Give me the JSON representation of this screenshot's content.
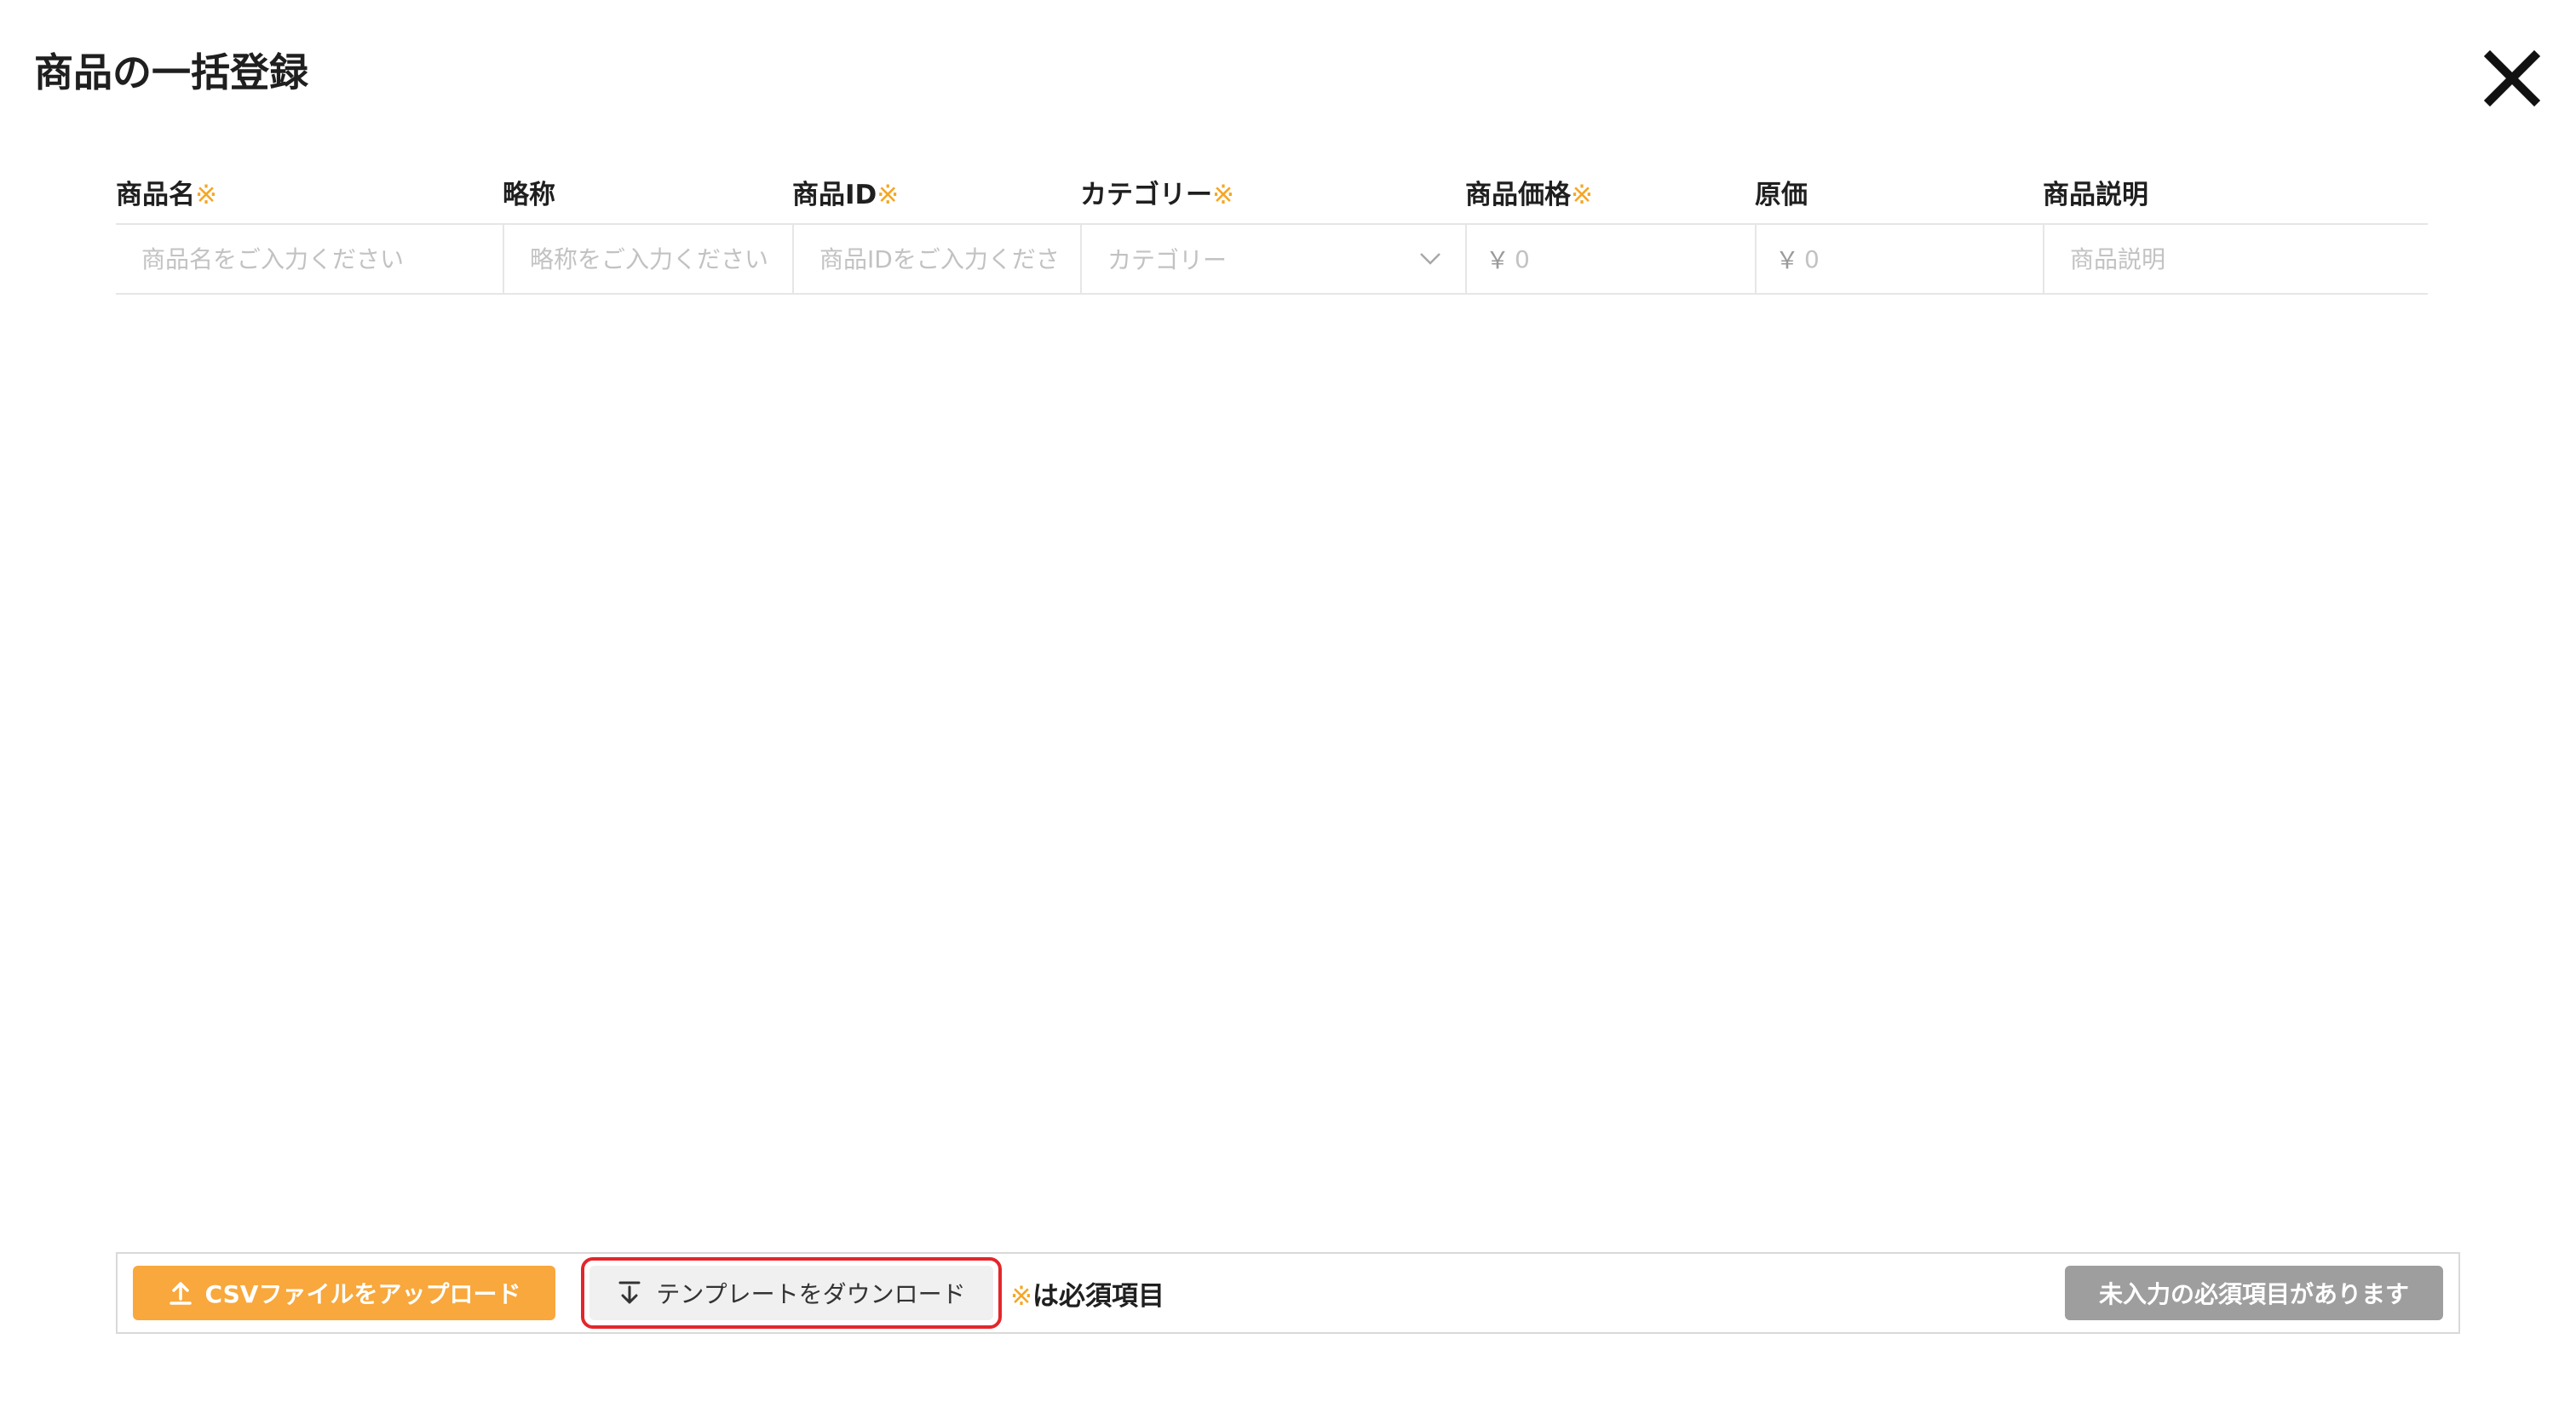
{
  "title": "商品の一括登録",
  "required_mark": "※",
  "columns": [
    {
      "label": "商品名",
      "required": true
    },
    {
      "label": "略称",
      "required": false
    },
    {
      "label": "商品ID",
      "required": true
    },
    {
      "label": "カテゴリー",
      "required": true
    },
    {
      "label": "商品価格",
      "required": true
    },
    {
      "label": "原価",
      "required": false
    },
    {
      "label": "商品説明",
      "required": false
    }
  ],
  "row": {
    "name_placeholder": "商品名をご入力ください",
    "short_name_placeholder": "略称をご入力ください",
    "product_id_placeholder": "商品IDをご入力ください",
    "category_placeholder": "カテゴリー",
    "currency_symbol": "￥",
    "price_placeholder": "0",
    "cost_placeholder": "0",
    "description_placeholder": "商品説明"
  },
  "footer": {
    "upload_label": "CSVファイルをアップロード",
    "download_label": "テンプレートをダウンロード",
    "required_note": "は必須項目",
    "submit_label": "未入力の必須項目があります"
  },
  "icons": {
    "close": "close-icon",
    "upload": "upload-icon",
    "download": "download-icon",
    "dropdown": "chevron-down-icon"
  },
  "colors": {
    "accent": "#f8a83c",
    "required_mark": "#f5a623",
    "highlight_border": "#e3262b",
    "disabled_button": "#9e9e9e"
  }
}
